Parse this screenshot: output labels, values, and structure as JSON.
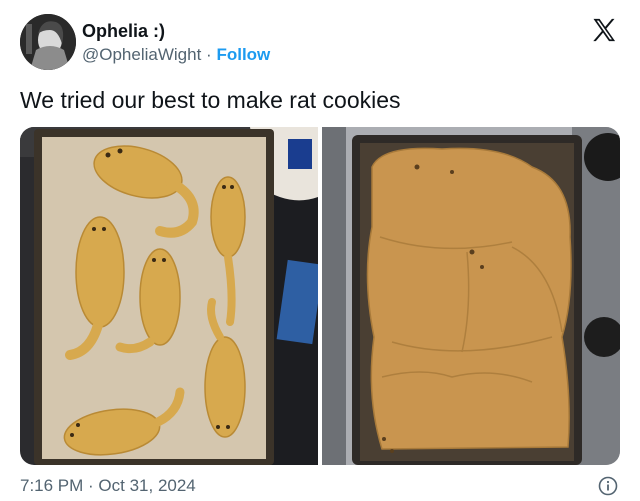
{
  "tweet": {
    "display_name": "Ophelia :)",
    "handle": "@OpheliaWight",
    "separator": "·",
    "follow_label": "Follow",
    "text": "We tried our best to make rat cookies",
    "timestamp": "7:16 PM · Oct 31, 2024"
  },
  "icons": {
    "platform_logo": "x-logo-icon",
    "info": "info-icon"
  },
  "colors": {
    "accent": "#1d9bf0",
    "text_primary": "#0f1419",
    "text_secondary": "#536471"
  },
  "media": {
    "photo_count": 2,
    "photos": [
      {
        "name": "unbaked-rat-cookies"
      },
      {
        "name": "baked-merged-cookies"
      }
    ]
  }
}
